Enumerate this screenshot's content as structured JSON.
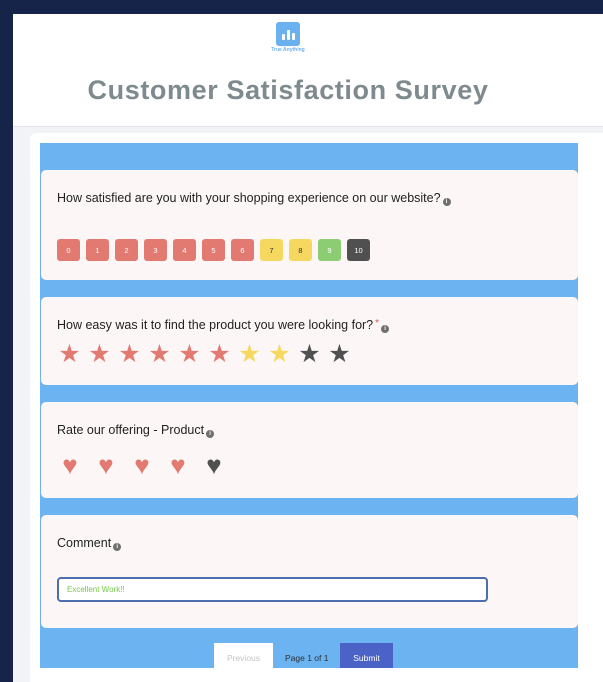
{
  "brand": {
    "name": "True Anything"
  },
  "survey": {
    "title": "Customer Satisfaction Survey"
  },
  "questions": [
    {
      "text": "How satisfied are you with your shopping experience on our website?",
      "type": "nps",
      "options": [
        "0",
        "1",
        "2",
        "3",
        "4",
        "5",
        "6",
        "7",
        "8",
        "9",
        "10"
      ]
    },
    {
      "text": "How easy was it to find the product you were looking for?",
      "type": "stars",
      "required_mark": "*",
      "count": 10
    },
    {
      "text": "Rate our offering - Product",
      "type": "hearts",
      "count": 5
    },
    {
      "text": "Comment",
      "type": "text",
      "value": "Excellent Work!!"
    }
  ],
  "footer": {
    "previous_label": "Previous",
    "page_info": "Page 1 of 1",
    "submit_label": "Submit"
  },
  "colors": {
    "background": "#17244a",
    "accent_blue": "#6cb3f2",
    "rating_red": "#e27a72",
    "rating_yellow": "#f6d860",
    "rating_green": "#8ccd74",
    "rating_dark": "#505050",
    "submit_button": "#4b63c6"
  }
}
